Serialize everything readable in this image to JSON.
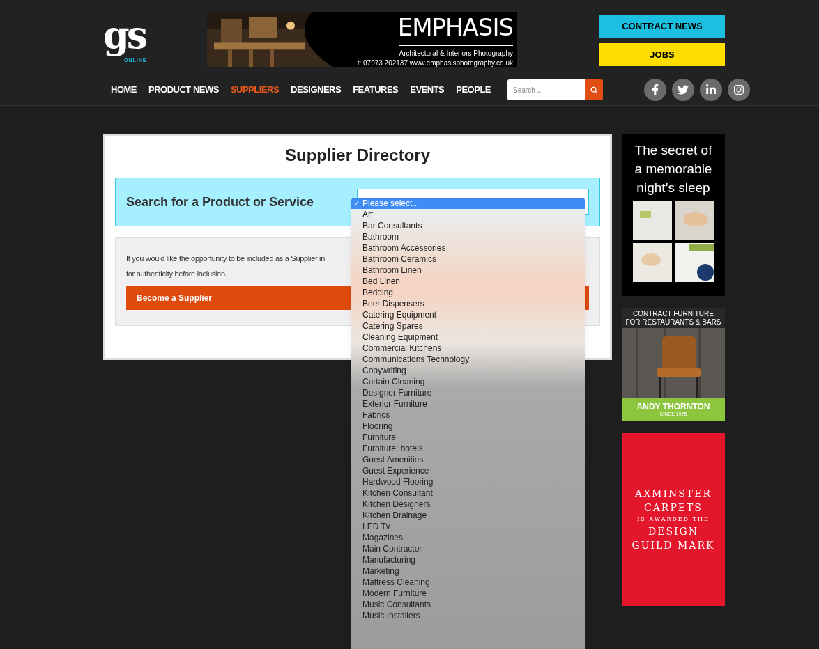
{
  "logo": {
    "mark": "gs",
    "sub": "ONLINE"
  },
  "banner": {
    "brand": "EMPHASIS",
    "tagline": "Architectural & Interiors Photography",
    "contact": "t: 07973 202137 www.emphasisphotography.co.uk"
  },
  "header_buttons": [
    {
      "label": "CONTRACT NEWS",
      "color": "#1bbfe0"
    },
    {
      "label": "JOBS",
      "color": "#ffdd00"
    }
  ],
  "nav": [
    {
      "label": "HOME",
      "selected": false
    },
    {
      "label": "PRODUCT NEWS",
      "selected": false
    },
    {
      "label": "SUPPLIERS",
      "selected": true
    },
    {
      "label": "DESIGNERS",
      "selected": false
    },
    {
      "label": "FEATURES",
      "selected": false
    },
    {
      "label": "EVENTS",
      "selected": false
    },
    {
      "label": "PEOPLE",
      "selected": false
    }
  ],
  "search": {
    "placeholder": "Search ..."
  },
  "social": [
    {
      "kind": "facebook"
    },
    {
      "kind": "twitter"
    },
    {
      "kind": "linkedin"
    },
    {
      "kind": "instagram"
    }
  ],
  "directory": {
    "title": "Supplier Directory",
    "search_label": "Search for a Product or Service",
    "info_line_1": "If you would like the opportunity to be included as a Supplier in",
    "info_line_2": "for authenticity before inclusion.",
    "button": "Become a Supplier"
  },
  "dropdown": {
    "options": [
      {
        "label": "Please select...",
        "selected": true,
        "mark": "✓"
      },
      {
        "label": "Art",
        "selected": false
      },
      {
        "label": "Bar Consultants",
        "selected": false
      },
      {
        "label": "Bathroom",
        "selected": false
      },
      {
        "label": "Bathroom Accessories",
        "selected": false
      },
      {
        "label": "Bathroom Ceramics",
        "selected": false
      },
      {
        "label": "Bathroom Linen",
        "selected": false
      },
      {
        "label": "Bed Linen",
        "selected": false
      },
      {
        "label": "Bedding",
        "selected": false
      },
      {
        "label": "Beer Dispensers",
        "selected": false
      },
      {
        "label": "Catering Equipment",
        "selected": false
      },
      {
        "label": "Catering Spares",
        "selected": false
      },
      {
        "label": "Cleaning Equipment",
        "selected": false
      },
      {
        "label": "Commercial Kitchens",
        "selected": false
      },
      {
        "label": "Communications Technology",
        "selected": false
      },
      {
        "label": "Copywriting",
        "selected": false
      },
      {
        "label": "Curtain Cleaning",
        "selected": false
      },
      {
        "label": "Designer Furniture",
        "selected": false
      },
      {
        "label": "Exterior Furniture",
        "selected": false
      },
      {
        "label": "Fabrics",
        "selected": false
      },
      {
        "label": "Flooring",
        "selected": false
      },
      {
        "label": "Furniture",
        "selected": false
      },
      {
        "label": "Furniture: hotels",
        "selected": false
      },
      {
        "label": "Guest Amenities",
        "selected": false
      },
      {
        "label": "Guest Experience",
        "selected": false
      },
      {
        "label": "Hardwood Flooring",
        "selected": false
      },
      {
        "label": "Kitchen Consultant",
        "selected": false
      },
      {
        "label": "Kitchen Designers",
        "selected": false
      },
      {
        "label": "Kitchen Drainage",
        "selected": false
      },
      {
        "label": "LED Tv",
        "selected": false
      },
      {
        "label": "Magazines",
        "selected": false
      },
      {
        "label": "Main Contractor",
        "selected": false
      },
      {
        "label": "Manufacturing",
        "selected": false
      },
      {
        "label": "Marketing",
        "selected": false
      },
      {
        "label": "Mattress Cleaning",
        "selected": false
      },
      {
        "label": "Modern Furniture",
        "selected": false
      },
      {
        "label": "Music Consultants",
        "selected": false
      },
      {
        "label": "Music Installers",
        "selected": false
      }
    ]
  },
  "ads": [
    {
      "kind": "sleep",
      "lines": [
        "The secret of",
        "a memorable",
        "night’s sleep"
      ]
    },
    {
      "kind": "furniture",
      "lines": [
        "CONTRACT FURNITURE",
        "FOR RESTAURANTS & BARS"
      ],
      "brand": "ANDY THORNTON",
      "since": "SINCE 1975"
    },
    {
      "kind": "carpets",
      "lines": [
        "AXMINSTER",
        "CARPETS",
        "IS AWARDED THE",
        "DESIGN",
        "GUILD MARK"
      ]
    }
  ]
}
